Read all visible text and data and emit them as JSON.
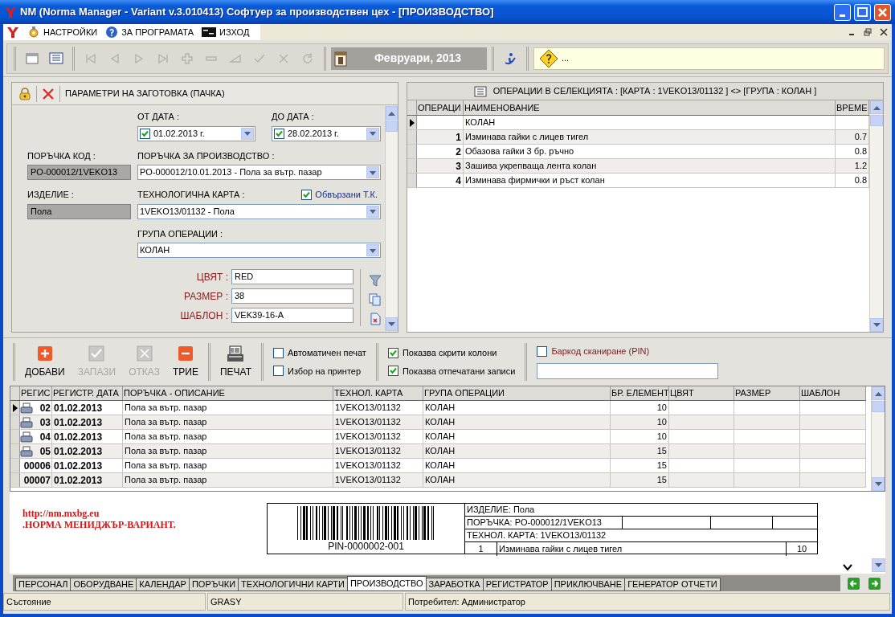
{
  "window": {
    "title": "NM (Norma Manager - Variant v.3.010413) Софтуер за производствен цех - [ПРОИЗВОДСТВО]"
  },
  "menu": [
    {
      "label": "НАСТРОЙКИ",
      "kind": "settings"
    },
    {
      "label": "ЗА ПРОГРАМАТА",
      "kind": "help"
    },
    {
      "label": "ИЗХОД",
      "kind": "exit"
    }
  ],
  "toolbar": {
    "view_buttons": [
      {
        "kind": "window"
      },
      {
        "kind": "list"
      }
    ],
    "nav_buttons": [
      {
        "kind": "first",
        "disabled": true
      },
      {
        "kind": "prev",
        "disabled": true
      },
      {
        "kind": "next",
        "disabled": true
      },
      {
        "kind": "last",
        "disabled": true
      },
      {
        "kind": "insert",
        "disabled": true
      },
      {
        "kind": "delete",
        "disabled": true
      },
      {
        "kind": "edit",
        "disabled": true
      },
      {
        "kind": "post",
        "disabled": true
      },
      {
        "kind": "cancel",
        "disabled": true
      },
      {
        "kind": "refresh",
        "disabled": true
      }
    ],
    "period": "Февруари, 2013",
    "hint": "..."
  },
  "params": {
    "title": "ПАРАМЕТРИ НА ЗАГОТОВКА (ПАЧКА)",
    "from_date": {
      "label": "ОТ ДАТА :",
      "value": "01.02.2013 г.",
      "checked": true
    },
    "to_date": {
      "label": "ДО ДАТА :",
      "value": "28.02.2013 г.",
      "checked": true
    },
    "order_code": {
      "label": "ПОРЪЧКА КОД :",
      "value": "PO-000012/1VEKO13"
    },
    "order": {
      "label": "ПОРЪЧКА ЗА ПРОИЗВОДСТВО :",
      "value": "PO-000012/10.01.2013 - Пола за вътр. пазар"
    },
    "product": {
      "label": "ИЗДЕЛИЕ  :",
      "value": "Пола"
    },
    "tech_card": {
      "label": "ТЕХНОЛОГИЧНА КАРТА :",
      "value": "1VEKO13/01132 - Пола"
    },
    "linked": {
      "label": "Обвързани Т.К.",
      "checked": true
    },
    "op_group": {
      "label": "ГРУПА ОПЕРАЦИИ :",
      "value": "КОЛАН"
    },
    "attributes": [
      {
        "label": "ЦВЯТ :",
        "value": "RED",
        "kind": "filter"
      },
      {
        "label": "РАЗМЕР :",
        "value": "38",
        "kind": "copy"
      },
      {
        "label": "ШАБЛОН :",
        "value": "VEK39-16-A",
        "kind": "remove"
      }
    ]
  },
  "operations": {
    "title": "ОПЕРАЦИИ В СЕЛЕКЦИЯТА : [КАРТА : 1VEKO13/01132 ] <> [ГРУПА : КОЛАН ]",
    "columns": [
      "ОПЕРАЦИ",
      "НАИМЕНОВАНИЕ",
      "ВРЕМЕ"
    ],
    "rows": [
      {
        "name": "КОЛАН",
        "selected": true
      },
      {
        "number": "1",
        "name": "Изминава гайки с лицев тигел",
        "time": "0.7",
        "selected": false
      },
      {
        "number": "2",
        "name": "Обазова гайки 3 бр. ръчно",
        "time": "0.8",
        "selected": false
      },
      {
        "number": "3",
        "name": "Зашива укрепваща лента колан",
        "time": "1.2",
        "selected": false
      },
      {
        "number": "4",
        "name": "Изминава фирмички и ръст колан",
        "time": "0.8",
        "selected": false
      }
    ]
  },
  "actions": {
    "buttons": [
      {
        "label": "ДОБАВИ",
        "kind": "add",
        "disabled": false
      },
      {
        "label": "ЗАПАЗИ",
        "kind": "save",
        "disabled": true
      },
      {
        "label": "ОТКАЗ",
        "kind": "cancel",
        "disabled": true
      },
      {
        "label": "ТРИЕ",
        "kind": "delete",
        "disabled": false
      },
      {
        "label": "ПЕЧАТ",
        "kind": "print",
        "disabled": false
      }
    ],
    "print_options": [
      {
        "label": "Автоматичен печат",
        "checked": false
      },
      {
        "label": "Избор на принтер",
        "checked": false
      }
    ],
    "view_options": [
      {
        "label": "Показва скрити колони",
        "checked": true
      },
      {
        "label": "Показва отпечатани записи",
        "checked": true
      }
    ],
    "barcode_scan": {
      "label": "Баркод сканиране (PIN)",
      "checked": false
    }
  },
  "records": {
    "columns": [
      "РЕГИС",
      "РЕГИСТР. ДАТА",
      "ПОРЪЧКА - ОПИСАНИЕ",
      "ТЕХНОЛ. КАРТА",
      "ГРУПА ОПЕРАЦИИ",
      "БР. ЕЛЕМЕНТ",
      "ЦВЯТ",
      "РАЗМЕР",
      "ШАБЛОН"
    ],
    "rows": [
      {
        "reg": "02",
        "printed": true,
        "selected": true,
        "date": "01.02.2013",
        "description": "Пола за вътр. пазар",
        "card": "1VEKO13/01132",
        "group": "КОЛАН",
        "count": "10"
      },
      {
        "reg": "03",
        "printed": true,
        "selected": false,
        "date": "01.02.2013",
        "description": "Пола за вътр. пазар",
        "card": "1VEKO13/01132",
        "group": "КОЛАН",
        "count": "10"
      },
      {
        "reg": "04",
        "printed": true,
        "selected": false,
        "date": "01.02.2013",
        "description": "Пола за вътр. пазар",
        "card": "1VEKO13/01132",
        "group": "КОЛАН",
        "count": "10"
      },
      {
        "reg": "05",
        "printed": true,
        "selected": false,
        "date": "01.02.2013",
        "description": "Пола за вътр. пазар",
        "card": "1VEKO13/01132",
        "group": "КОЛАН",
        "count": "15"
      },
      {
        "reg": "00006",
        "printed": false,
        "selected": false,
        "date": "01.02.2013",
        "description": "Пола за вътр. пазар",
        "card": "1VEKO13/01132",
        "group": "КОЛАН",
        "count": "15"
      },
      {
        "reg": "00007",
        "printed": false,
        "selected": false,
        "date": "01.02.2013",
        "description": "Пола за вътр. пазар",
        "card": "1VEKO13/01132",
        "group": "КОЛАН",
        "count": "15"
      }
    ]
  },
  "preview": {
    "link": "http://nm.mxbg.eu",
    "brand": ".НОРМА МЕНИДЖЪР-ВАРИАНТ.",
    "label": {
      "pin": "PIN-0000002-001",
      "product": "ИЗДЕЛИЕ: Пола",
      "order": "ПОРЪЧКА: PO-000012/1VEKO13",
      "card": "ТЕХНОЛ. КАРТА: 1VEKO13/01132",
      "op_number": "1",
      "op_name": "Изминава гайки с лицев тигел",
      "count": "10"
    }
  },
  "tabs": [
    {
      "label": "ПЕРСОНАЛ",
      "selected": false
    },
    {
      "label": "ОБОРУДВАНЕ",
      "selected": false
    },
    {
      "label": "КАЛЕНДАР",
      "selected": false
    },
    {
      "label": "ПОРЪЧКИ",
      "selected": false
    },
    {
      "label": "ТЕХНОЛОГИЧНИ КАРТИ",
      "selected": false
    },
    {
      "label": "ПРОИЗВОДСТВО",
      "selected": true
    },
    {
      "label": "ЗАРАБОТКА",
      "selected": false
    },
    {
      "label": "РЕГИСТРАТОР",
      "selected": false
    },
    {
      "label": "ПРИКЛЮЧВАНЕ",
      "selected": false
    },
    {
      "label": "ГЕНЕРАТОР ОТЧЕТИ",
      "selected": false
    }
  ],
  "status_bar": [
    "Състояние",
    "GRASY",
    "Потребител: Администратор"
  ]
}
